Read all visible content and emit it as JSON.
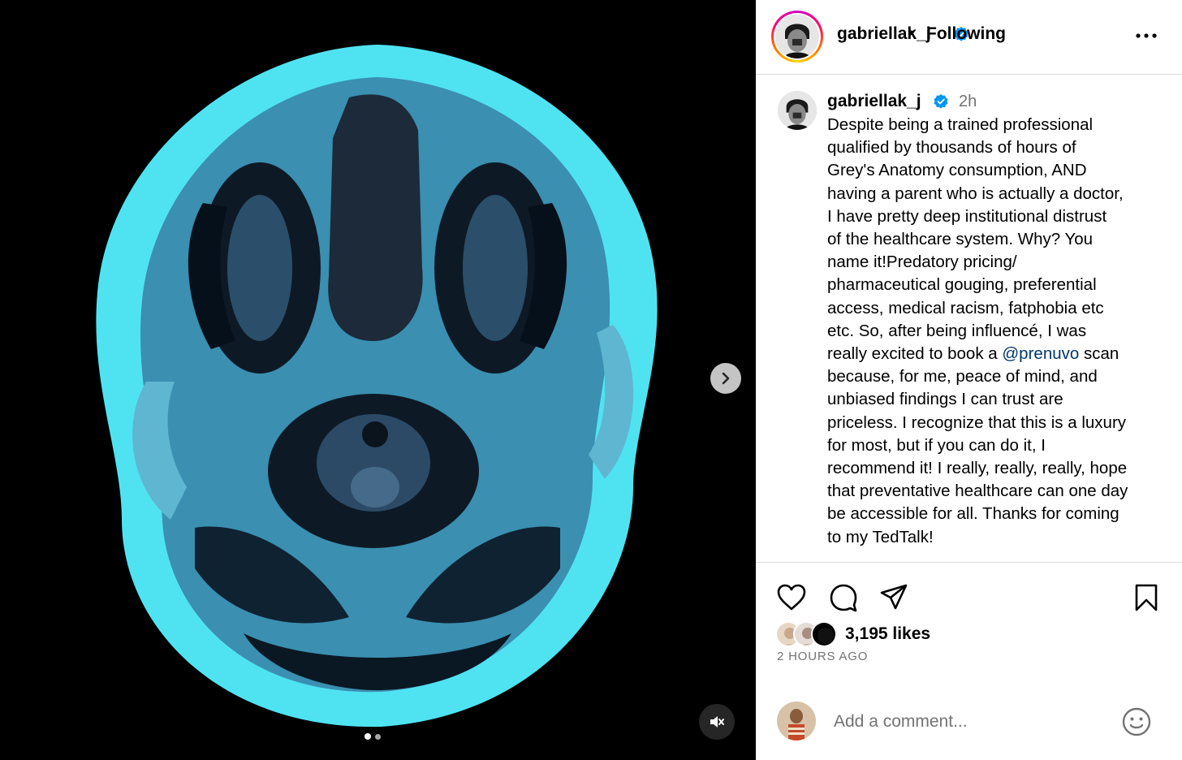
{
  "post": {
    "username": "gabriellak_j",
    "follow_status": "Following",
    "separator": "•",
    "media": {
      "slide_count": 2,
      "active_slide": 1
    }
  },
  "caption": {
    "username": "gabriellak_j",
    "time": "2h",
    "text_before_mention": "Despite being a trained professional\nqualified by thousands of hours of\nGrey's Anatomy consumption, AND\nhaving a parent who is actually a doctor,\nI have pretty deep institutional distrust\nof the healthcare system. Why? You\nname it!Predatory pricing/\npharmaceutical gouging, preferential\naccess, medical racism, fatphobia etc\netc. So, after being influencé, I was\nreally excited to book a ",
    "mention": "@prenuvo",
    "text_after_mention": " scan\nbecause, for me, peace of mind, and\nunbiased findings I can trust are\npriceless. I recognize that this is a luxury\nfor most, but if you can do it, I\nrecommend it! I really, really, really, hope\nthat preventative healthcare can one day\nbe accessible for all. Thanks for coming\nto my TedTalk!"
  },
  "engagement": {
    "likes": "3,195 likes",
    "time_ago": "2 HOURS AGO"
  },
  "comment": {
    "placeholder": "Add a comment..."
  },
  "icons": {
    "like": "heart-icon",
    "comment": "comment-icon",
    "share": "send-icon",
    "save": "bookmark-icon",
    "more": "more-icon",
    "next": "chevron-right-icon",
    "mute": "muted-speaker-icon",
    "emoji": "emoji-icon",
    "verified": "verified-badge-icon"
  },
  "colors": {
    "verified": "#0095f6",
    "mention": "#00376b",
    "scan_cyan": "#4fe3f2",
    "secondary_text": "#737373"
  }
}
